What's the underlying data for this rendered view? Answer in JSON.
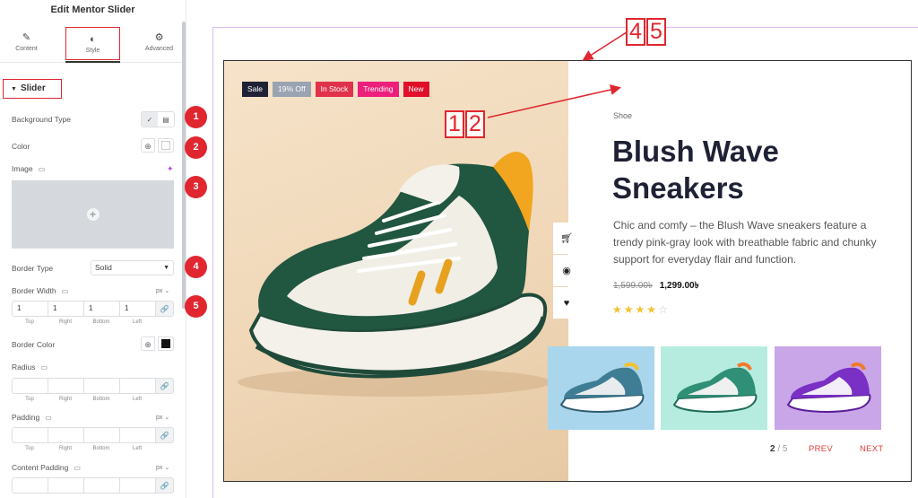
{
  "panel": {
    "title": "Edit Mentor Slider",
    "tabs": [
      {
        "label": "Content",
        "icon": "pencil-icon"
      },
      {
        "label": "Style",
        "icon": "contrast-icon"
      },
      {
        "label": "Advanced",
        "icon": "gear-icon"
      }
    ],
    "active_tab": "Style",
    "section": "Slider",
    "background_type_label": "Background Type",
    "color_label": "Color",
    "image_label": "Image",
    "border_type_label": "Border Type",
    "border_type_value": "Solid",
    "border_width_label": "Border Width",
    "border_width_unit": "px",
    "border_width_values": [
      "1",
      "1",
      "1",
      "1"
    ],
    "dim_labels": [
      "Top",
      "Right",
      "Bottom",
      "Left"
    ],
    "border_color_label": "Border Color",
    "radius_label": "Radius",
    "padding_label": "Padding",
    "padding_unit": "px",
    "content_padding_label": "Content Padding",
    "content_padding_unit": "px"
  },
  "markers": [
    "1",
    "2",
    "3",
    "4",
    "5"
  ],
  "callouts": {
    "top": [
      "4",
      "5"
    ],
    "middle": [
      "1",
      "2"
    ]
  },
  "product": {
    "badges": [
      {
        "text": "Sale",
        "color": "#1f2235"
      },
      {
        "text": "19% Off",
        "color": "#9aa3b1"
      },
      {
        "text": "In Stock",
        "color": "#e0324b"
      },
      {
        "text": "Trending",
        "color": "#ec1f7c"
      },
      {
        "text": "New",
        "color": "#e0102a"
      }
    ],
    "category": "Shoe",
    "title": "Blush Wave Sneakers",
    "description": "Chic and comfy – the Blush Wave sneakers feature a trendy pink-gray look with breathable fabric and chunky support for everyday flair and function.",
    "old_price": "1,599.00৳",
    "new_price": "1,299.00৳",
    "rating": 4,
    "rating_max": 5,
    "side_icons": [
      "cart-icon",
      "eye-icon",
      "heart-icon"
    ]
  },
  "pager": {
    "current": "2",
    "separator": " / ",
    "total": "5",
    "prev": "PREV",
    "next": "NEXT"
  },
  "colors": {
    "accent_red": "#e0262f",
    "title": "#1f2235",
    "canvas_border": "#e3b8ef"
  }
}
